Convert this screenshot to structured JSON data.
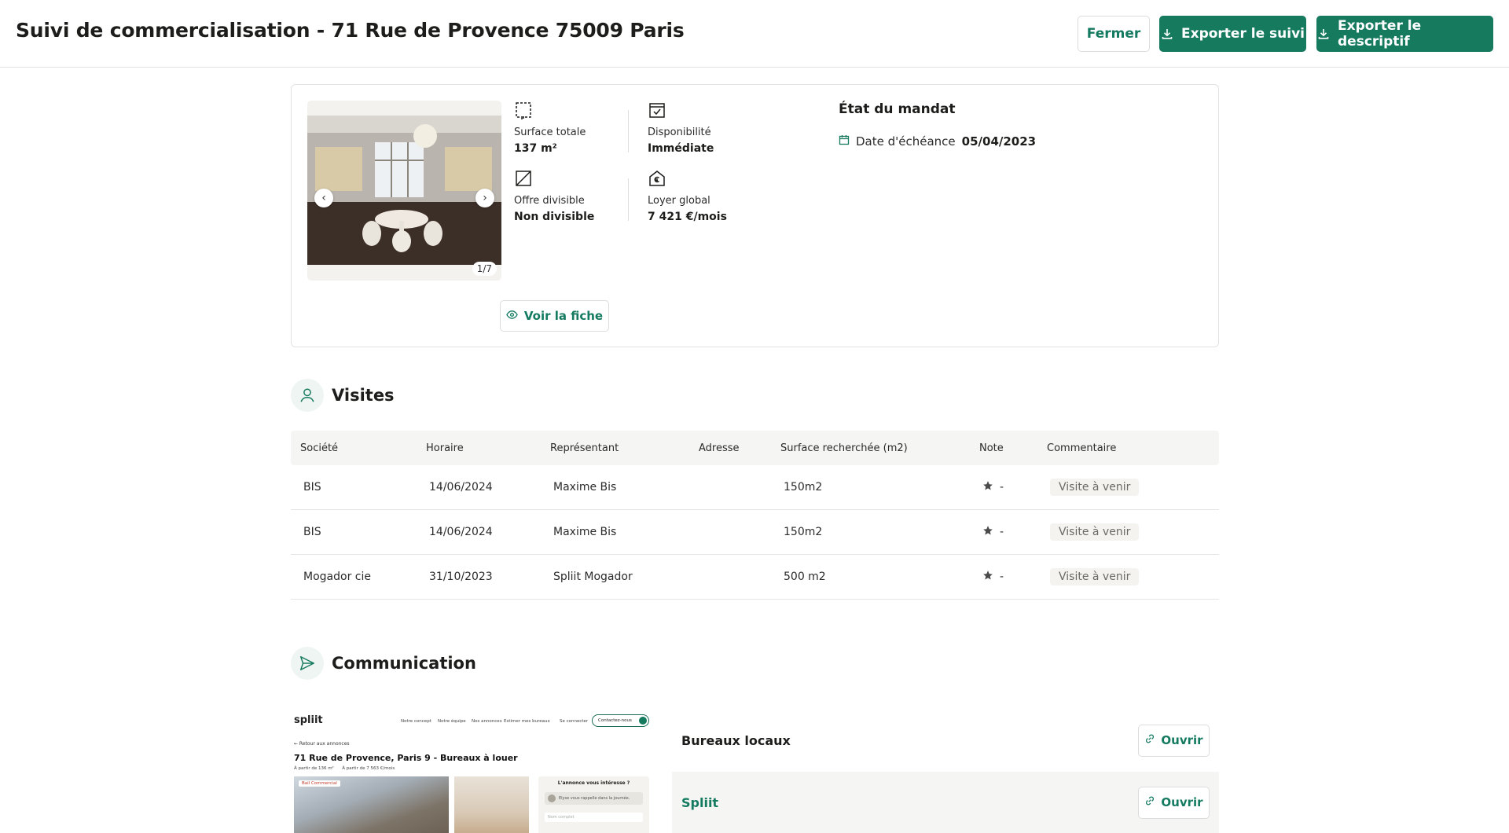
{
  "header": {
    "title": "Suivi de commercialisation - 71 Rue de Provence 75009 Paris",
    "close_label": "Fermer",
    "export_tracking_label": "Exporter le suivi",
    "export_desc_label": "Exporter le descriptif"
  },
  "property": {
    "photo_counter": "1/7",
    "specs": {
      "surface": {
        "label": "Surface totale",
        "value": "137 m²",
        "icon": "surface-icon"
      },
      "availability": {
        "label": "Disponibilité",
        "value": "Immédiate",
        "icon": "calendar-check-icon"
      },
      "divisible": {
        "label": "Offre divisible",
        "value": "Non divisible",
        "icon": "not-divisible-icon"
      },
      "rent": {
        "label": "Loyer global",
        "value": "7 421 €/mois",
        "icon": "euro-house-icon"
      }
    },
    "mandate": {
      "title": "État du mandat",
      "deadline_label": "Date d'échéance",
      "deadline_value": "05/04/2023"
    },
    "view_label": "Voir la fiche"
  },
  "visits": {
    "title": "Visites",
    "columns": [
      "Société",
      "Horaire",
      "Représentant",
      "Adresse",
      "Surface recherchée (m2)",
      "Note",
      "Commentaire"
    ],
    "rows": [
      {
        "company": "BIS",
        "time": "14/06/2024",
        "rep": "Maxime Bis",
        "address": "",
        "surface": "150m2",
        "note": "-",
        "comment": "Visite à venir"
      },
      {
        "company": "BIS",
        "time": "14/06/2024",
        "rep": "Maxime Bis",
        "address": "",
        "surface": "150m2",
        "note": "-",
        "comment": "Visite à venir"
      },
      {
        "company": "Mogador cie",
        "time": "31/10/2023",
        "rep": "Spliit Mogador",
        "address": "",
        "surface": "500 m2",
        "note": "-",
        "comment": "Visite à venir"
      }
    ]
  },
  "communication": {
    "title": "Communication",
    "preview": {
      "logo": "spliit",
      "nav": [
        "Notre concept",
        "Notre équipe",
        "Nos annonces",
        "Estimer mes bureaux",
        "Se connecter"
      ],
      "contact": "Contactez-nous",
      "back": "← Retour aux annonces",
      "title": "71 Rue de Provence, Paris 9 - Bureaux à louer",
      "sub1": "À partir de 136 m²",
      "sub2": "À partir de 7 563 €/mois",
      "tag": "Bail Commercial",
      "box_title": "L'annonce vous intéresse ?",
      "box_msg": "Elyse vous rappelle dans la journée.",
      "box_input": "Nom complet"
    },
    "links": [
      {
        "name": "Bureaux locaux",
        "action": "Ouvrir"
      },
      {
        "name": "Spliit",
        "action": "Ouvrir"
      }
    ]
  },
  "colors": {
    "accent": "#167a5f",
    "accent_text": "#147a60"
  }
}
